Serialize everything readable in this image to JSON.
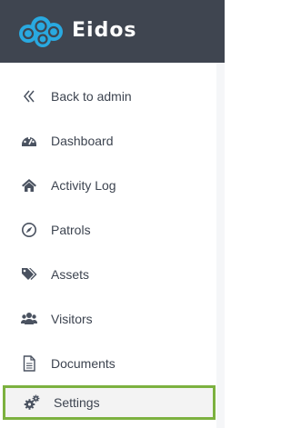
{
  "app": {
    "name": "Eidos"
  },
  "menu": [
    {
      "label": "Back to admin",
      "icon": "double-chevron-left-icon"
    },
    {
      "label": "Dashboard",
      "icon": "dashboard-gauge-icon"
    },
    {
      "label": "Activity Log",
      "icon": "home-icon"
    },
    {
      "label": "Patrols",
      "icon": "compass-icon"
    },
    {
      "label": "Assets",
      "icon": "tags-icon"
    },
    {
      "label": "Visitors",
      "icon": "users-icon"
    },
    {
      "label": "Documents",
      "icon": "document-icon"
    },
    {
      "label": "Settings",
      "icon": "cogs-icon",
      "active": true
    }
  ],
  "colors": {
    "header": "#3f4550",
    "brand": "#29a9e0",
    "active_border": "#7cb13f",
    "text": "#3d4450",
    "icon": "#4a5260"
  }
}
